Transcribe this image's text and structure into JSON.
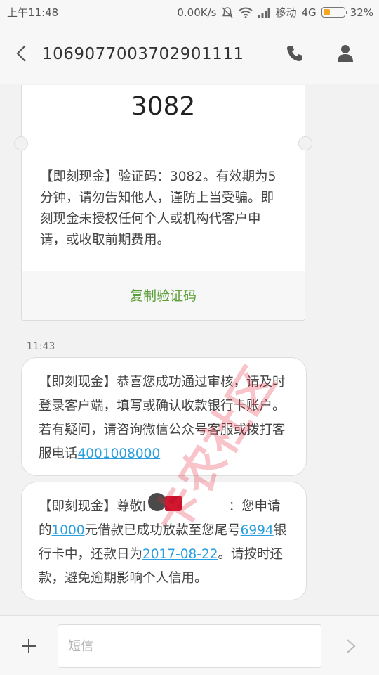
{
  "status_bar": {
    "time": "上午11:48",
    "network_speed": "0.00K/s",
    "carrier": "移动",
    "network_type": "4G",
    "battery": "32%",
    "battery_level": 0.32,
    "icons": [
      "mute-icon",
      "wifi-icon",
      "signal-icon",
      "battery-icon"
    ]
  },
  "header": {
    "title": "1069077003702901111",
    "icons": [
      "back-arrow-icon",
      "phone-icon",
      "person-icon"
    ]
  },
  "code_card": {
    "code": "3082",
    "message": "【即刻现金】验证码：3082。有效期为5分钟，请勿告知他人，谨防上当受骗。即刻现金未授权任何个人或机构代客户申请，或收取前期费用。",
    "copy_label": "复制验证码",
    "copy_color": "#5a9e37"
  },
  "timestamp": "11:43",
  "messages": [
    {
      "text_before": "【即刻现金】恭喜您成功通过审核，请及时登录客户端，填写或确认收款银行卡账户。若有疑问，请咨询微信公众号客服或拨打客服电话",
      "phone_link": "4001008000"
    },
    {
      "part1": "【即刻现金】尊敬的",
      "part2": "：您申请的",
      "amount_link": "1000",
      "part3": "元借款已成功放款至您尾号",
      "card_link": "6994",
      "part4": "银行卡中，还款日为",
      "date_link": "2017-08-22",
      "part5": "。请按时还款，避免逾期影响个人信用。"
    }
  ],
  "watermark": "卡农社区",
  "input": {
    "placeholder": "短信",
    "icons": [
      "plus-icon",
      "send-arrow-icon"
    ]
  },
  "colors": {
    "link": "#2a9fe0",
    "battery_fill": "#f5a623"
  }
}
